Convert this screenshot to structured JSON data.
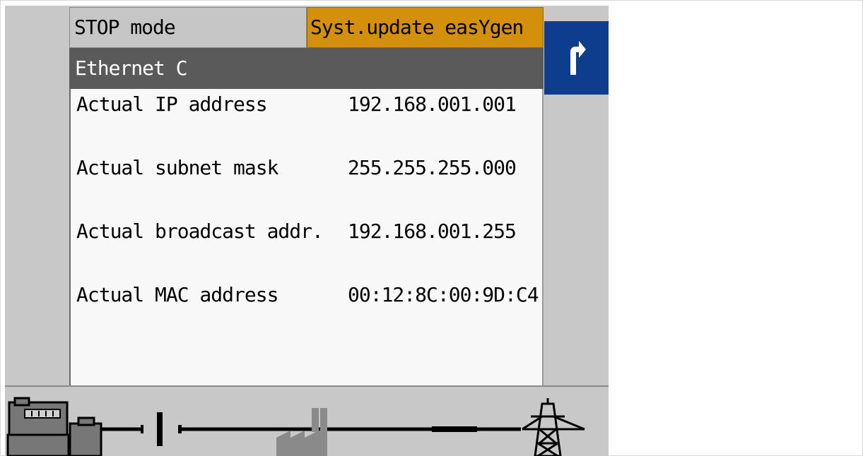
{
  "header": {
    "mode": "STOP mode",
    "alarm": "Syst.update easYgen",
    "alarm_color": "#d4900a"
  },
  "back_button": {
    "icon": "turn-arrow-icon",
    "color": "#0d3d8c"
  },
  "page": {
    "title": "Ethernet C"
  },
  "rows": [
    {
      "label": "Actual IP address",
      "value": "192.168.001.001"
    },
    {
      "label": "Actual subnet mask",
      "value": "255.255.255.000"
    },
    {
      "label": "Actual broadcast addr.",
      "value": "192.168.001.255"
    },
    {
      "label": "Actual MAC address",
      "value": "00:12:8C:00:9D:C4"
    }
  ],
  "single_line_diagram": {
    "icons": [
      "generator-icon",
      "breaker-open-icon",
      "load-factory-icon",
      "mains-tower-icon"
    ]
  }
}
